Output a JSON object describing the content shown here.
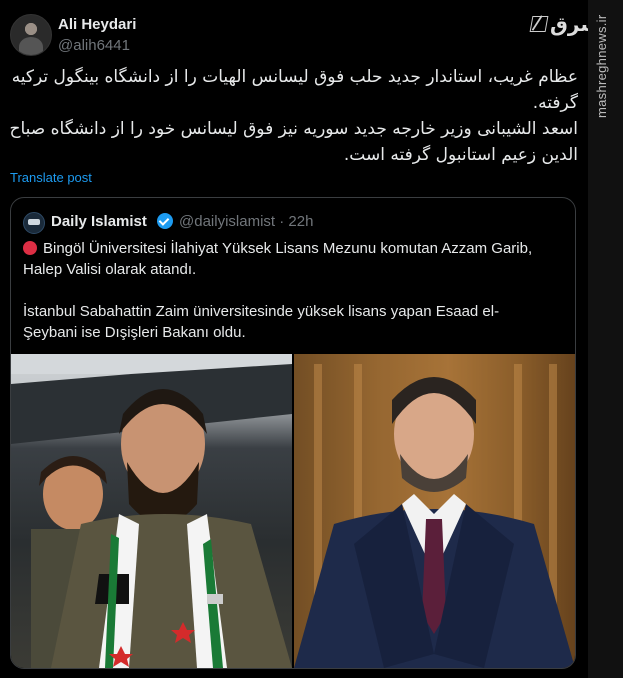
{
  "author": {
    "name": "Ali Heydari",
    "handle": "@alih6441"
  },
  "watermark": {
    "logo_text": "مشرق",
    "site": "mashreghnews.ir"
  },
  "tweet_lines": [
    "عظام غریب، استاندار جدید حلب فوق لیسانس الهیات را از دانشگاه بینگول ترکیه",
    "گرفته.",
    "اسعد الشیبانی وزیر خارجه جدید سوریه نیز فوق لیسانس خود را از دانشگاه صباح",
    "الدین زعیم استانبول گرفته است."
  ],
  "translate_label": "Translate post",
  "quoted": {
    "name": "Daily Islamist",
    "handle_time": "@dailyislamist · 22h",
    "line1": "Bingöl Üniversitesi İlahiyat Yüksek Lisans Mezunu komutan Azzam Garib,",
    "line2": "Halep Valisi olarak atandı.",
    "line3": "İstanbul Sabahattin Zaim üniversitesinde yüksek lisans yapan Esaad el-",
    "line4": "Şeybani ise Dışişleri Bakanı oldu."
  },
  "colors": {
    "link": "#1d9bf0",
    "verified": "#1d9bf0",
    "red_circle": "#dd2e44",
    "background": "#000000"
  }
}
